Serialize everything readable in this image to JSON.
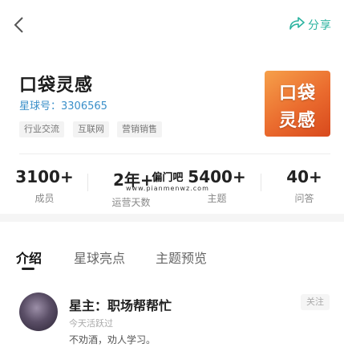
{
  "header": {
    "share_label": "分享"
  },
  "group": {
    "title": "口袋灵感",
    "id_text": "星球号：3306565",
    "tags": [
      "行业交流",
      "互联网",
      "营销销售"
    ],
    "cover_text": [
      "口袋",
      "灵感"
    ]
  },
  "stats": [
    {
      "value": "3100+",
      "label": "成员"
    },
    {
      "value": "2年+",
      "label": "运营天数"
    },
    {
      "value": "5400+",
      "label": "主题"
    },
    {
      "value": "40+",
      "label": "问答"
    }
  ],
  "watermark": {
    "main": "偏门吧",
    "sub": "www.pianmenwz.com"
  },
  "tabs": [
    "介绍",
    "星球亮点",
    "主题预览"
  ],
  "owner": {
    "name": "星主：职场帮帮忙",
    "active": "今天活跃过",
    "bio": "不劝酒，劝人学习。",
    "follow_label": "关注"
  },
  "colors": {
    "accent": "#2bb3a0",
    "link": "#3a8fc9",
    "cover": "#ea6b2e"
  }
}
